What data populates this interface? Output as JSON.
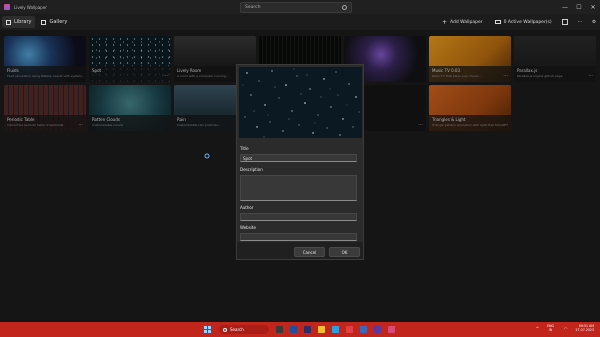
{
  "app": {
    "title": "Lively Wallpaper"
  },
  "search": {
    "placeholder": "Search"
  },
  "nav": {
    "library": "Library",
    "gallery": "Gallery"
  },
  "toolbar": {
    "add_wallpaper": "Add Wallpaper",
    "active_wallpapers": "0 Active Wallpaper(s)"
  },
  "tiles": [
    {
      "title": "Fluids",
      "desc": "Fluid simulation using WebGL, reacts with system audio & cursor."
    },
    {
      "title": "Spot",
      "desc": ""
    },
    {
      "title": "Lively Room",
      "desc": "A room with a computer running..."
    },
    {
      "title": "",
      "desc": ""
    },
    {
      "title": "",
      "desc": ""
    },
    {
      "title": "Music TV 0.03",
      "desc": "Retro TV that plays your music..."
    },
    {
      "title": "Parallax.js",
      "desc": "Parallax.js engine github page"
    },
    {
      "title": "Periodic Table",
      "desc": "Interactive periodic table of elements"
    },
    {
      "title": "Rotten Clouds",
      "desc": "Customizable clouds"
    },
    {
      "title": "Rain",
      "desc": "Customizable rain particles..."
    },
    {
      "title": "",
      "desc": ""
    },
    {
      "title": "Triangles & Light",
      "desc": "Triangle pattern animation with light that follows cursor."
    }
  ],
  "dialog": {
    "title_label": "Title",
    "title_value": "Spot",
    "description_label": "Description",
    "description_value": "",
    "author_label": "Author",
    "author_value": "",
    "website_label": "Website",
    "website_value": "",
    "cancel": "Cancel",
    "ok": "OK"
  },
  "taskbar": {
    "search": "Search",
    "lang1": "ENG",
    "lang2": "IN",
    "time": "09:51 AM",
    "date": "27-07-2023"
  },
  "colors": {
    "taskbar": "#c1251b",
    "app_bg": "#1c1c1c",
    "dialog_bg": "#2b2b2b"
  }
}
